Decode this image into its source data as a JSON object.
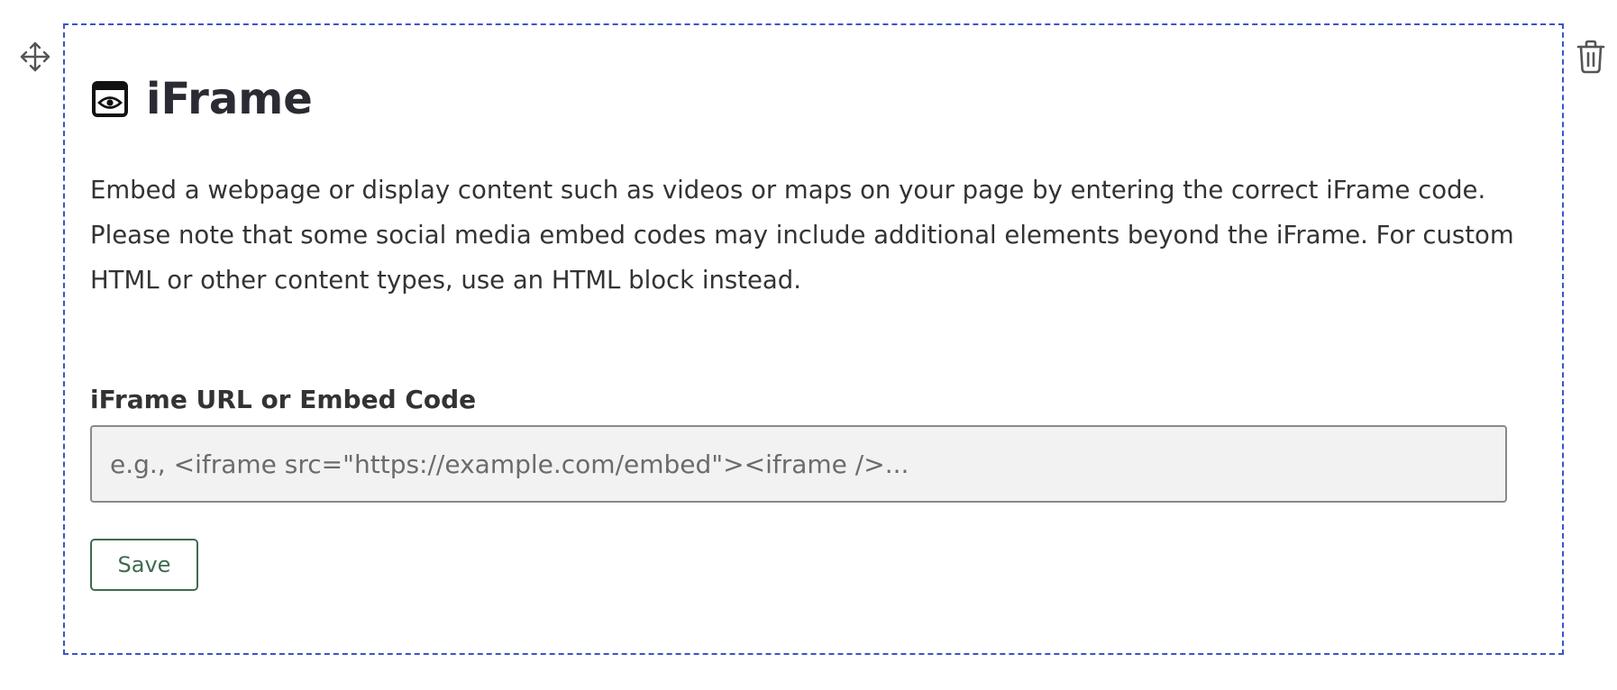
{
  "block": {
    "title": "iFrame",
    "title_icon": "eye-in-window-icon",
    "description": "Embed a webpage or display content such as videos or maps on your page by entering the correct iFrame code. Please note that some social media embed codes may include additional elements beyond the iFrame. For custom HTML or other content types, use an HTML block instead.",
    "field_label": "iFrame URL or Embed Code",
    "input": {
      "value": "",
      "placeholder": "e.g., <iframe src=\"https://example.com/embed\"><iframe />..."
    },
    "save_label": "Save"
  },
  "controls": {
    "drag_icon": "move-arrows-icon",
    "delete_icon": "trash-icon"
  },
  "colors": {
    "selection_border": "#3a55c9",
    "save_accent": "#3f6b50",
    "input_background": "#f2f2f2",
    "text": "#333333"
  }
}
